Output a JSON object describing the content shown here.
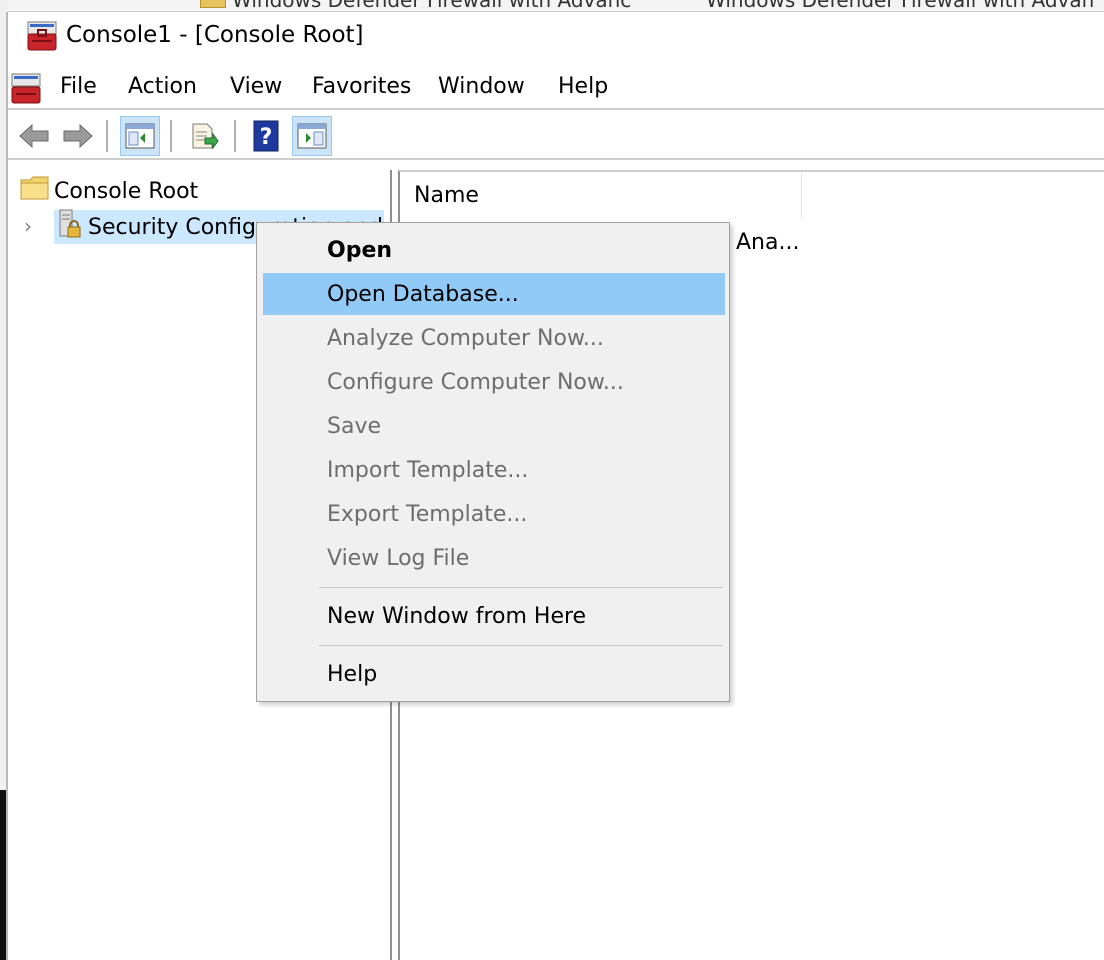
{
  "window": {
    "title": "Console1 - [Console Root]"
  },
  "background_window": {
    "tab1": "Windows Defender Firewall with Advanc",
    "tab2": "Windows Defender Firewall with Advan"
  },
  "menubar": {
    "items": [
      "File",
      "Action",
      "View",
      "Favorites",
      "Window",
      "Help"
    ]
  },
  "toolbar": {
    "buttons": [
      {
        "icon": "back-arrow-icon"
      },
      {
        "icon": "forward-arrow-icon"
      },
      {
        "icon": "show-hide-console-tree-icon"
      },
      {
        "icon": "export-list-icon"
      },
      {
        "icon": "help-icon"
      },
      {
        "icon": "show-hide-action-pane-icon"
      }
    ]
  },
  "tree": {
    "root_label": "Console Root",
    "child_label": "Security Configuration and"
  },
  "list": {
    "column_name": "Name",
    "row_text": "Ana..."
  },
  "context_menu": {
    "items": [
      {
        "label": "Open",
        "bold": true,
        "enabled": true
      },
      {
        "label": "Open Database...",
        "enabled": true,
        "highlighted": true
      },
      {
        "label": "Analyze Computer Now...",
        "enabled": false
      },
      {
        "label": "Configure Computer Now...",
        "enabled": false
      },
      {
        "label": "Save",
        "enabled": false
      },
      {
        "label": "Import Template...",
        "enabled": false
      },
      {
        "label": "Export Template...",
        "enabled": false
      },
      {
        "label": "View Log File",
        "enabled": false
      },
      {
        "label": "New Window from Here",
        "enabled": true
      },
      {
        "label": "Help",
        "enabled": true
      }
    ]
  },
  "colors": {
    "highlight": "#91c9f7",
    "selected": "#cce8ff",
    "disabled_text": "#6d6d6d",
    "menu_bg": "#f0f0f0"
  }
}
